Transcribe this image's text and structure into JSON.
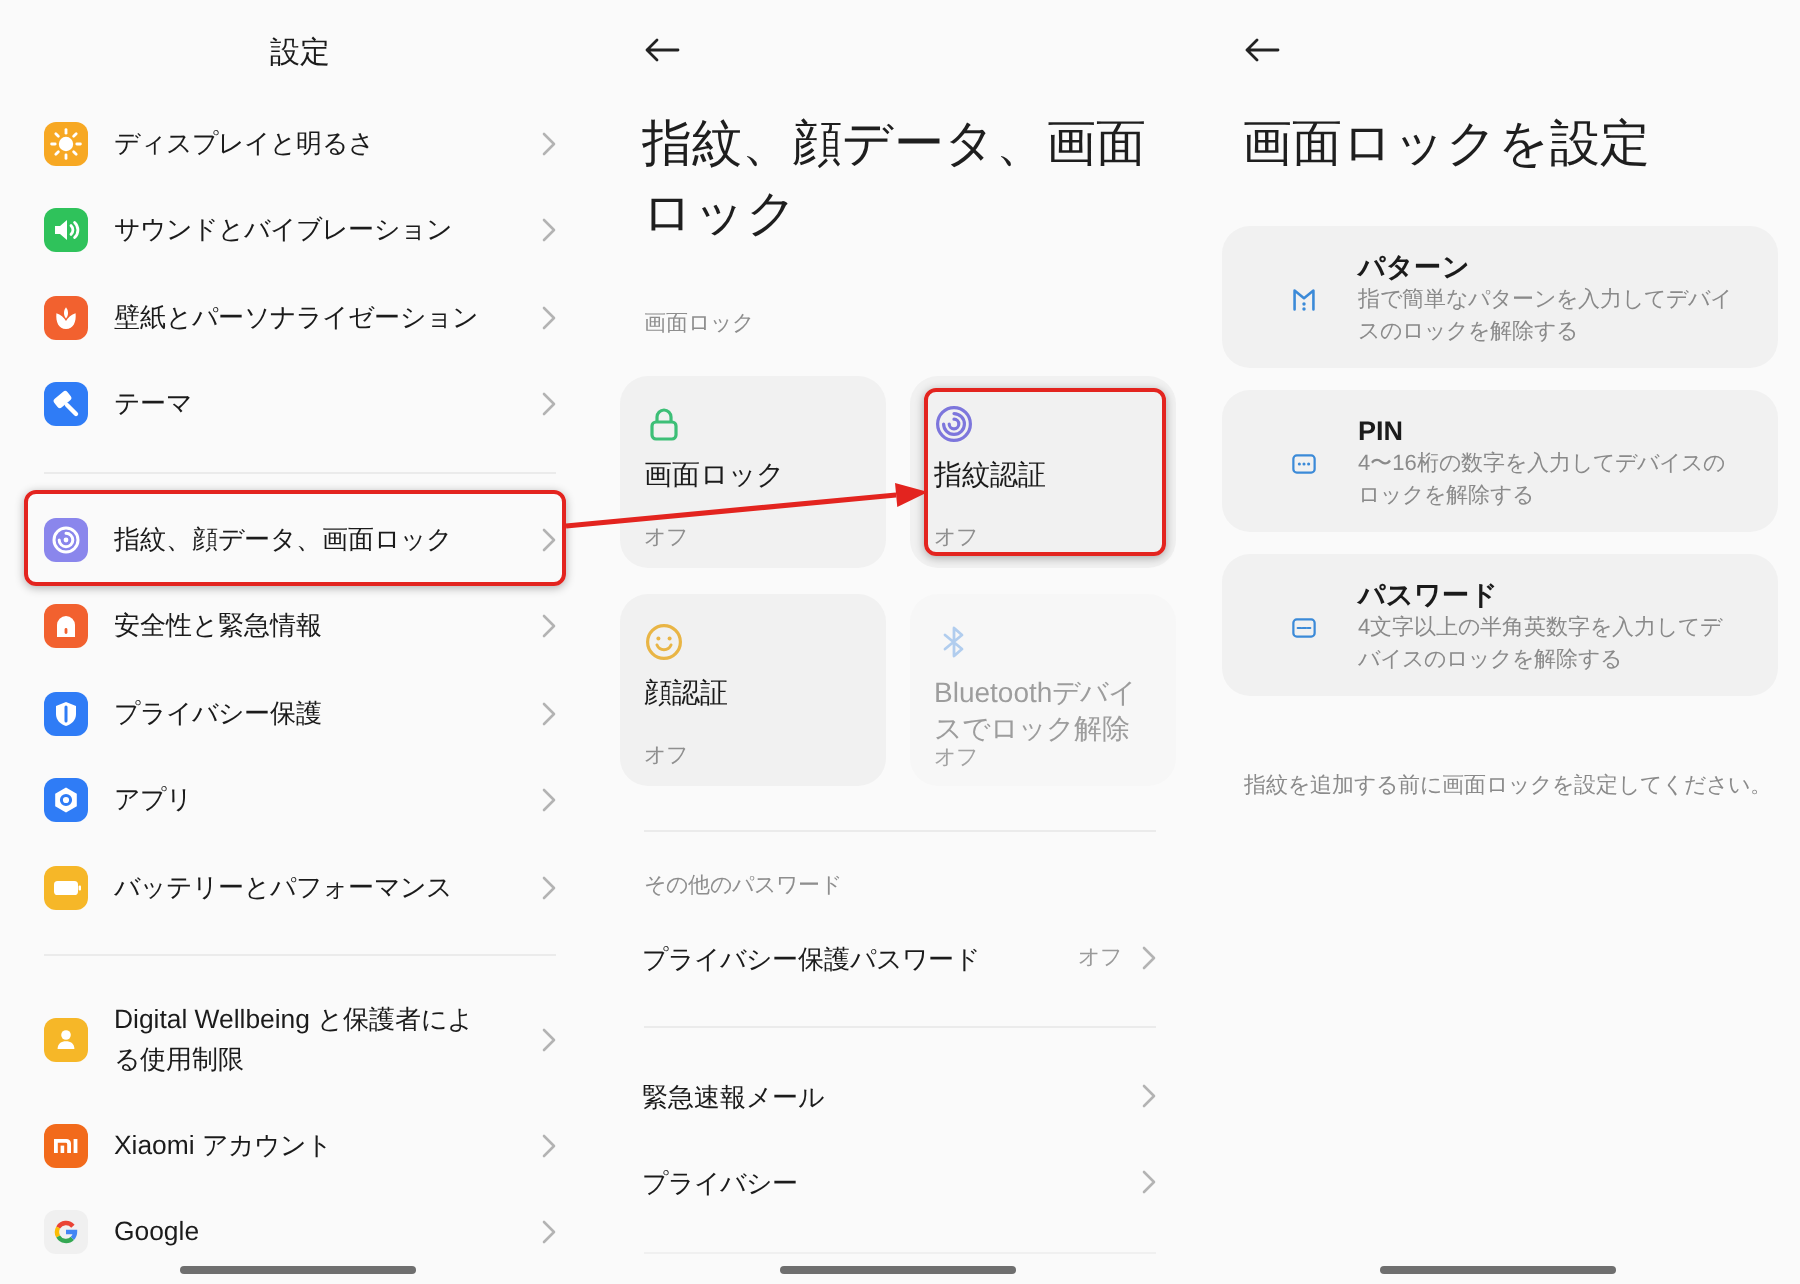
{
  "settings_screen": {
    "title": "設定",
    "groups": [
      {
        "items": [
          {
            "kind": "display",
            "label": "ディスプレイと明るさ",
            "color": "#f7a823",
            "highlighted": false
          },
          {
            "kind": "sound",
            "label": "サウンドとバイブレーション",
            "color": "#2fc25b",
            "highlighted": false
          },
          {
            "kind": "wallpaper",
            "label": "壁紙とパーソナライゼーション",
            "color": "#f2612f",
            "highlighted": false
          },
          {
            "kind": "theme",
            "label": "テーマ",
            "color": "#2f7cf6",
            "highlighted": false
          }
        ]
      },
      {
        "items": [
          {
            "kind": "biometrics",
            "label": "指紋、顔データ、画面ロック",
            "color": "#8a86ec",
            "highlighted": true
          },
          {
            "kind": "safety",
            "label": "安全性と緊急情報",
            "color": "#f2612f",
            "highlighted": false
          },
          {
            "kind": "privacy",
            "label": "プライバシー保護",
            "color": "#2f7cf6",
            "highlighted": false
          },
          {
            "kind": "apps",
            "label": "アプリ",
            "color": "#2f7cf6",
            "highlighted": false
          },
          {
            "kind": "battery",
            "label": "バッテリーとパフォーマンス",
            "color": "#f6b728",
            "highlighted": false
          }
        ]
      },
      {
        "items": [
          {
            "kind": "wellbeing",
            "label": "Digital Wellbeing と保護者による使用制限",
            "color": "#f6b728",
            "highlighted": false
          },
          {
            "kind": "account",
            "label": "Xiaomi アカウント",
            "color": "#f26a1b",
            "highlighted": false
          },
          {
            "kind": "google",
            "label": "Google",
            "color": "#f0f0f0",
            "highlighted": false
          }
        ]
      }
    ]
  },
  "biometrics_screen": {
    "title": "指紋、顔データ、画面ロック",
    "lock_section": {
      "label": "画面ロック",
      "cards": [
        {
          "kind": "lock",
          "title": "画面ロック",
          "status": "オフ",
          "disabled": false,
          "highlighted": false
        },
        {
          "kind": "fingerprint",
          "title": "指紋認証",
          "status": "オフ",
          "disabled": false,
          "highlighted": true
        },
        {
          "kind": "face",
          "title": "顔認証",
          "status": "オフ",
          "disabled": false,
          "highlighted": false
        },
        {
          "kind": "bluetooth",
          "title": "Bluetoothデバイスでロック解除",
          "status": "オフ",
          "disabled": true,
          "highlighted": false
        }
      ]
    },
    "password_section": {
      "label": "その他のパスワード",
      "rows": [
        {
          "label": "プライバシー保護パスワード",
          "value": "オフ"
        }
      ]
    },
    "more_rows": [
      {
        "label": "緊急速報メール"
      },
      {
        "label": "プライバシー"
      }
    ]
  },
  "lock_setup_screen": {
    "title": "画面ロックを設定",
    "options": [
      {
        "kind": "pattern",
        "title": "パターン",
        "description": "指で簡単なパターンを入力してデバイスのロックを解除する"
      },
      {
        "kind": "pin",
        "title": "PIN",
        "description": "4〜16桁の数字を入力してデバイスのロックを解除する"
      },
      {
        "kind": "password",
        "title": "パスワード",
        "description": "4文字以上の半角英数字を入力してデバイスのロックを解除する"
      }
    ],
    "note": "指紋を追加する前に画面ロックを設定してください。"
  }
}
